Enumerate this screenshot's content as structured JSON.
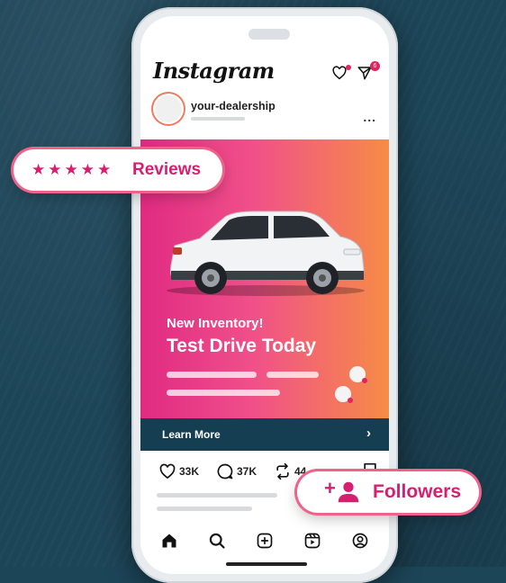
{
  "app": {
    "logo": "Instagram",
    "notification_badge": "6"
  },
  "post": {
    "username": "your-dealership",
    "more": "...",
    "kicker": "New Inventory!",
    "headline": "Test Drive Today",
    "cta_label": "Learn More",
    "cta_chevron": "›",
    "likes": "33K",
    "comments": "37K",
    "reposts": "44"
  },
  "floating": {
    "reviews_stars": "★★★★★",
    "reviews_label": "Reviews",
    "add_user_plus": "+",
    "followers_label": "Followers"
  },
  "colors": {
    "accent": "#d61f6f",
    "gradient_start": "#e02a82",
    "gradient_end": "#f68c46",
    "cta_bg": "#163e52",
    "background": "#1d4558"
  },
  "icons": {
    "header": [
      "heart-icon",
      "send-icon"
    ],
    "actions": [
      "heart-icon",
      "comment-icon",
      "repost-icon",
      "bookmark-icon"
    ],
    "nav": [
      "home-icon",
      "search-icon",
      "add-post-icon",
      "reels-icon",
      "profile-icon"
    ]
  }
}
